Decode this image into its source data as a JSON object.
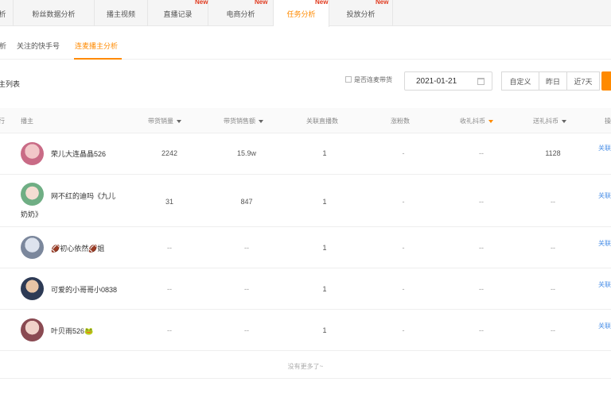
{
  "top_tabs": [
    {
      "label": "析"
    },
    {
      "label": "粉丝数据分析"
    },
    {
      "label": "播主视频"
    },
    {
      "label": "直播记录",
      "badge": "New"
    },
    {
      "label": "电商分析",
      "badge": "New"
    },
    {
      "label": "任务分析",
      "badge": "New"
    },
    {
      "label": "投放分析",
      "badge": "New"
    }
  ],
  "sub_tabs": [
    {
      "label": "析"
    },
    {
      "label": "关注的快手号"
    },
    {
      "label": "连麦播主分析"
    }
  ],
  "toolbar": {
    "section_title": "主列表",
    "checkbox_label": "是否连麦带货",
    "date_value": "2021-01-21",
    "segments": [
      "自定义",
      "昨日",
      "近7天"
    ]
  },
  "table": {
    "headers": [
      "行",
      "播主",
      "带货销量",
      "带货销售额",
      "关联直播数",
      "涨粉数",
      "收礼抖币",
      "送礼抖币",
      "操"
    ],
    "rows": [
      {
        "name": "荣儿大连晶晶526",
        "name_line2": "",
        "sales": "2242",
        "amount": "15.9w",
        "lives": "1",
        "fans": "-",
        "gifts_received": "--",
        "gifts_sent": "1128",
        "action": "关联"
      },
      {
        "name": "网不红的迪吗《九儿",
        "name_line2": "奶奶》",
        "sales": "31",
        "amount": "847",
        "lives": "1",
        "fans": "-",
        "gifts_received": "--",
        "gifts_sent": "--",
        "action": "关联"
      },
      {
        "name": "🏈初心依然🏈姐",
        "name_line2": "",
        "sales": "--",
        "amount": "--",
        "lives": "1",
        "fans": "-",
        "gifts_received": "--",
        "gifts_sent": "--",
        "action": "关联"
      },
      {
        "name": "可爱的小哥哥小0838",
        "name_line2": "",
        "sales": "--",
        "amount": "--",
        "lives": "1",
        "fans": "-",
        "gifts_received": "--",
        "gifts_sent": "--",
        "action": "关联"
      },
      {
        "name": "叶贝雨526🐸",
        "name_line2": "",
        "sales": "--",
        "amount": "--",
        "lives": "1",
        "fans": "-",
        "gifts_received": "--",
        "gifts_sent": "--",
        "action": "关联"
      }
    ],
    "footer": "没有更多了~"
  },
  "colors": {
    "accent": "#ff8a00",
    "badge": "#e03a1e",
    "link": "#4a8fe7"
  }
}
